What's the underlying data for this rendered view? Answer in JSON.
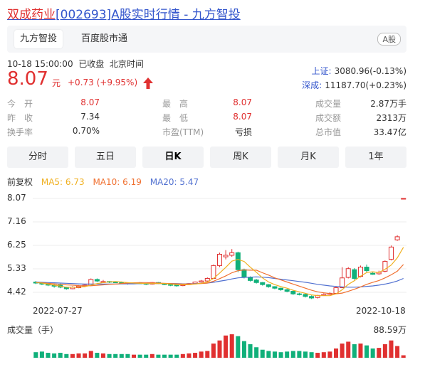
{
  "header": {
    "stock_name": "双成药业",
    "rest": "[002693]A股实时行情 - 九方智投"
  },
  "tabs": [
    {
      "label": "九方智投"
    },
    {
      "label": "百度股市通"
    }
  ],
  "badge": "A股",
  "quote": {
    "timestamp": "10-18 15:00:00",
    "status": "已收盘",
    "timezone": "北京时间",
    "price": "8.07",
    "unit": "元",
    "change": "+0.73 (+9.95%)"
  },
  "indices": [
    {
      "name": "上证:",
      "value": "3080.96(-0.13%)"
    },
    {
      "name": "深成:",
      "value": "11187.70(+0.23%)"
    }
  ],
  "stats": {
    "open_label": "今　开",
    "open": "8.07",
    "prev_label": "昨　收",
    "prev": "7.34",
    "turnover_label": "换手率",
    "turnover": "0.70%",
    "high_label": "最　高",
    "high": "8.07",
    "low_label": "最　低",
    "low": "8.07",
    "pe_label": "市盈(TTM)",
    "pe": "亏损",
    "vol_label": "成交量",
    "vol": "2.87万手",
    "amt_label": "成交额",
    "amt": "2313万",
    "cap_label": "总市值",
    "cap": "33.47亿"
  },
  "periods": [
    {
      "label": "分时"
    },
    {
      "label": "五日"
    },
    {
      "label": "日K"
    },
    {
      "label": "周K"
    },
    {
      "label": "月K"
    },
    {
      "label": "1年"
    }
  ],
  "legend": {
    "adj": "前复权",
    "ma5": "MA5: 6.73",
    "ma10": "MA10: 6.19",
    "ma20": "MA20: 5.47"
  },
  "colors": {
    "up": "#e03030",
    "down": "#10b07a",
    "ma5": "#f0b020",
    "ma10": "#f07030",
    "ma20": "#5070d0",
    "link": "#3355cc"
  },
  "chart_data": {
    "type": "candlestick",
    "y_ticks": [
      "8.07",
      "7.16",
      "6.25",
      "5.33",
      "4.42"
    ],
    "x_ticks": [
      "2022-07-27",
      "2022-10-18"
    ],
    "ylim": [
      4.42,
      8.07
    ],
    "candles": [
      {
        "o": 4.82,
        "c": 4.78,
        "h": 4.86,
        "l": 4.74
      },
      {
        "o": 4.78,
        "c": 4.74,
        "h": 4.82,
        "l": 4.7
      },
      {
        "o": 4.74,
        "c": 4.7,
        "h": 4.78,
        "l": 4.66
      },
      {
        "o": 4.7,
        "c": 4.66,
        "h": 4.74,
        "l": 4.6
      },
      {
        "o": 4.7,
        "c": 4.62,
        "h": 4.76,
        "l": 4.58
      },
      {
        "o": 4.6,
        "c": 4.56,
        "h": 4.64,
        "l": 4.52
      },
      {
        "o": 4.56,
        "c": 4.62,
        "h": 4.66,
        "l": 4.54
      },
      {
        "o": 4.6,
        "c": 4.66,
        "h": 4.7,
        "l": 4.58
      },
      {
        "o": 4.66,
        "c": 4.7,
        "h": 4.74,
        "l": 4.62
      },
      {
        "o": 4.68,
        "c": 4.92,
        "h": 4.96,
        "l": 4.66
      },
      {
        "o": 4.92,
        "c": 4.86,
        "h": 4.96,
        "l": 4.82
      },
      {
        "o": 4.8,
        "c": 4.84,
        "h": 4.9,
        "l": 4.78
      },
      {
        "o": 4.84,
        "c": 4.82,
        "h": 4.86,
        "l": 4.78
      },
      {
        "o": 4.82,
        "c": 4.8,
        "h": 4.84,
        "l": 4.78
      },
      {
        "o": 4.8,
        "c": 4.78,
        "h": 4.84,
        "l": 4.76
      },
      {
        "o": 4.78,
        "c": 4.76,
        "h": 4.8,
        "l": 4.72
      },
      {
        "o": 4.76,
        "c": 4.78,
        "h": 4.8,
        "l": 4.74
      },
      {
        "o": 4.78,
        "c": 4.76,
        "h": 4.82,
        "l": 4.74
      },
      {
        "o": 4.76,
        "c": 4.74,
        "h": 4.78,
        "l": 4.7
      },
      {
        "o": 4.74,
        "c": 4.8,
        "h": 4.82,
        "l": 4.72
      },
      {
        "o": 4.8,
        "c": 4.76,
        "h": 4.82,
        "l": 4.74
      },
      {
        "o": 4.76,
        "c": 4.72,
        "h": 4.78,
        "l": 4.7
      },
      {
        "o": 4.72,
        "c": 4.7,
        "h": 4.74,
        "l": 4.66
      },
      {
        "o": 4.7,
        "c": 4.68,
        "h": 4.72,
        "l": 4.64
      },
      {
        "o": 4.68,
        "c": 4.72,
        "h": 4.74,
        "l": 4.66
      },
      {
        "o": 4.72,
        "c": 4.76,
        "h": 4.78,
        "l": 4.7
      },
      {
        "o": 4.76,
        "c": 4.82,
        "h": 4.84,
        "l": 4.74
      },
      {
        "o": 4.82,
        "c": 4.86,
        "h": 4.9,
        "l": 4.8
      },
      {
        "o": 4.86,
        "c": 4.96,
        "h": 5.0,
        "l": 4.84
      },
      {
        "o": 4.96,
        "c": 5.46,
        "h": 5.5,
        "l": 4.94
      },
      {
        "o": 5.46,
        "c": 5.9,
        "h": 5.96,
        "l": 5.4
      },
      {
        "o": 5.8,
        "c": 5.86,
        "h": 6.06,
        "l": 5.7
      },
      {
        "o": 5.86,
        "c": 5.96,
        "h": 6.1,
        "l": 5.8
      },
      {
        "o": 5.96,
        "c": 5.3,
        "h": 6.0,
        "l": 5.2
      },
      {
        "o": 5.3,
        "c": 5.02,
        "h": 5.34,
        "l": 4.96
      },
      {
        "o": 5.0,
        "c": 4.88,
        "h": 5.04,
        "l": 4.84
      },
      {
        "o": 4.9,
        "c": 4.8,
        "h": 4.94,
        "l": 4.76
      },
      {
        "o": 4.8,
        "c": 4.72,
        "h": 4.82,
        "l": 4.68
      },
      {
        "o": 4.72,
        "c": 4.64,
        "h": 4.74,
        "l": 4.6
      },
      {
        "o": 4.64,
        "c": 4.58,
        "h": 4.66,
        "l": 4.54
      },
      {
        "o": 4.58,
        "c": 4.52,
        "h": 4.6,
        "l": 4.48
      },
      {
        "o": 4.52,
        "c": 4.46,
        "h": 4.56,
        "l": 4.42
      },
      {
        "o": 4.46,
        "c": 4.36,
        "h": 4.5,
        "l": 4.32
      },
      {
        "o": 4.36,
        "c": 4.34,
        "h": 4.4,
        "l": 4.3
      },
      {
        "o": 4.34,
        "c": 4.26,
        "h": 4.38,
        "l": 4.22
      },
      {
        "o": 4.26,
        "c": 4.2,
        "h": 4.3,
        "l": 4.16
      },
      {
        "o": 4.22,
        "c": 4.3,
        "h": 4.32,
        "l": 4.18
      },
      {
        "o": 4.3,
        "c": 4.34,
        "h": 4.38,
        "l": 4.28
      },
      {
        "o": 4.34,
        "c": 4.38,
        "h": 4.42,
        "l": 4.32
      },
      {
        "o": 4.38,
        "c": 4.6,
        "h": 4.64,
        "l": 4.36
      },
      {
        "o": 4.6,
        "c": 4.98,
        "h": 5.4,
        "l": 4.58
      },
      {
        "o": 5.0,
        "c": 5.34,
        "h": 5.4,
        "l": 4.96
      },
      {
        "o": 5.3,
        "c": 4.96,
        "h": 5.36,
        "l": 4.9
      },
      {
        "o": 5.04,
        "c": 5.4,
        "h": 5.46,
        "l": 5.0
      },
      {
        "o": 5.4,
        "c": 5.26,
        "h": 5.5,
        "l": 5.2
      },
      {
        "o": 5.16,
        "c": 5.12,
        "h": 5.2,
        "l": 5.1
      },
      {
        "o": 5.14,
        "c": 5.2,
        "h": 5.26,
        "l": 5.1
      },
      {
        "o": 5.24,
        "c": 5.62,
        "h": 5.66,
        "l": 5.2
      },
      {
        "o": 5.7,
        "c": 6.18,
        "h": 6.24,
        "l": 5.66
      },
      {
        "o": 6.46,
        "c": 6.58,
        "h": 6.64,
        "l": 6.42
      },
      {
        "o": 8.07,
        "c": 8.07,
        "h": 8.07,
        "l": 8.07
      }
    ],
    "ma5": [
      4.8,
      4.78,
      4.74,
      4.7,
      4.66,
      4.62,
      4.62,
      4.62,
      4.64,
      4.7,
      4.76,
      4.8,
      4.83,
      4.84,
      4.82,
      4.8,
      4.78,
      4.77,
      4.76,
      4.76,
      4.76,
      4.76,
      4.74,
      4.72,
      4.71,
      4.72,
      4.74,
      4.77,
      4.82,
      4.96,
      5.17,
      5.39,
      5.63,
      5.7,
      5.62,
      5.4,
      5.2,
      4.98,
      4.82,
      4.72,
      4.64,
      4.58,
      4.5,
      4.44,
      4.38,
      4.32,
      4.29,
      4.29,
      4.29,
      4.36,
      4.52,
      4.73,
      4.87,
      5.05,
      5.19,
      5.22,
      5.19,
      5.32,
      5.48,
      5.76,
      6.17
    ],
    "ma10": [
      4.8,
      4.79,
      4.77,
      4.75,
      4.73,
      4.71,
      4.7,
      4.68,
      4.67,
      4.68,
      4.69,
      4.71,
      4.73,
      4.74,
      4.76,
      4.78,
      4.79,
      4.8,
      4.8,
      4.79,
      4.78,
      4.77,
      4.76,
      4.75,
      4.74,
      4.74,
      4.75,
      4.76,
      4.78,
      4.85,
      4.95,
      5.06,
      5.18,
      5.26,
      5.29,
      5.28,
      5.28,
      5.18,
      5.09,
      4.98,
      4.9,
      4.82,
      4.74,
      4.66,
      4.58,
      4.5,
      4.44,
      4.4,
      4.37,
      4.36,
      4.39,
      4.46,
      4.54,
      4.63,
      4.73,
      4.81,
      4.88,
      4.98,
      5.1,
      5.24,
      5.5
    ],
    "ma20": [
      4.82,
      4.81,
      4.8,
      4.79,
      4.78,
      4.77,
      4.76,
      4.75,
      4.74,
      4.74,
      4.74,
      4.74,
      4.74,
      4.74,
      4.75,
      4.75,
      4.75,
      4.76,
      4.76,
      4.76,
      4.76,
      4.76,
      4.76,
      4.76,
      4.75,
      4.75,
      4.76,
      4.77,
      4.78,
      4.81,
      4.85,
      4.89,
      4.94,
      4.98,
      5.0,
      5.01,
      5.02,
      5.01,
      4.99,
      4.96,
      4.93,
      4.9,
      4.87,
      4.84,
      4.81,
      4.77,
      4.73,
      4.7,
      4.67,
      4.65,
      4.63,
      4.62,
      4.62,
      4.63,
      4.65,
      4.67,
      4.7,
      4.74,
      4.79,
      4.86,
      4.96
    ],
    "volume_label": "成交量（手）",
    "volume_max": "88.59万",
    "volumes": [
      18,
      20,
      16,
      14,
      16,
      12,
      12,
      14,
      14,
      22,
      16,
      14,
      12,
      12,
      12,
      12,
      10,
      10,
      10,
      12,
      10,
      10,
      10,
      10,
      12,
      14,
      16,
      20,
      22,
      46,
      56,
      72,
      76,
      70,
      54,
      44,
      34,
      26,
      22,
      20,
      18,
      20,
      22,
      22,
      20,
      18,
      16,
      18,
      20,
      30,
      46,
      52,
      44,
      46,
      40,
      30,
      32,
      44,
      56,
      38,
      8
    ]
  }
}
